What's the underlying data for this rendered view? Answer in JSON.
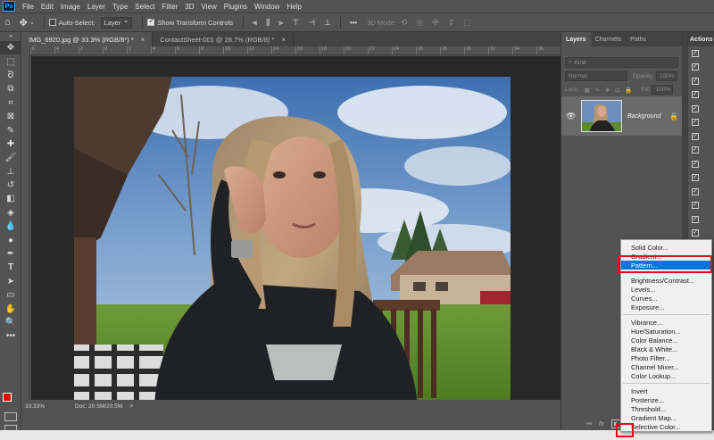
{
  "app": {
    "logo": "Ps"
  },
  "menu": [
    "File",
    "Edit",
    "Image",
    "Layer",
    "Type",
    "Select",
    "Filter",
    "3D",
    "View",
    "Plugins",
    "Window",
    "Help"
  ],
  "options": {
    "auto_select_label": "Auto-Select:",
    "auto_select_value": "Layer",
    "transform_label": "Show Transform Controls",
    "mode_3d_label": "3D Mode:",
    "more": "•••"
  },
  "tabs": [
    {
      "label": "IMG_6920.jpg @ 33.3% (RGB/8*) *",
      "close": "×"
    },
    {
      "label": "ContactSheet-001 @ 28.7% (RGB/8) *",
      "close": "×"
    }
  ],
  "ruler": [
    "6",
    "4",
    "2",
    "0",
    "2",
    "4",
    "6",
    "8",
    "10",
    "12",
    "14",
    "16",
    "18",
    "20",
    "22",
    "24",
    "26",
    "28",
    "30",
    "32",
    "34",
    "36"
  ],
  "status": {
    "zoom": "33.33%",
    "doc": "Doc: 20.5M/20.5M",
    "arrow": ">"
  },
  "layers_panel": {
    "tabs": [
      "Layers",
      "Channels",
      "Paths"
    ],
    "kind_label": "Kind",
    "blend_mode": "Normal",
    "opacity_label": "Opacity:",
    "opacity_value": "100%",
    "lock_label": "Lock:",
    "fill_label": "Fill:",
    "fill_value": "100%",
    "layer_name": "Background",
    "bottom_icons": [
      "⚯",
      "fx"
    ]
  },
  "actions_panel": {
    "title": "Actions",
    "rows": 24
  },
  "adjustment_menu": {
    "group1": [
      "Solid Color...",
      "Gradient...",
      "Pattern..."
    ],
    "group2": [
      "Brightness/Contrast...",
      "Levels...",
      "Curves...",
      "Exposure..."
    ],
    "group3": [
      "Vibrance...",
      "Hue/Saturation...",
      "Color Balance...",
      "Black & White...",
      "Photo Filter...",
      "Channel Mixer...",
      "Color Lookup..."
    ],
    "group4": [
      "Invert",
      "Posterize...",
      "Threshold...",
      "Gradient Map...",
      "Selective Color..."
    ],
    "selected": "Pattern..."
  },
  "colors": {
    "foreground": "#ee0000",
    "background": "#ffffff",
    "menu_highlight": "#0078d7",
    "annotation": "#e0101a"
  }
}
